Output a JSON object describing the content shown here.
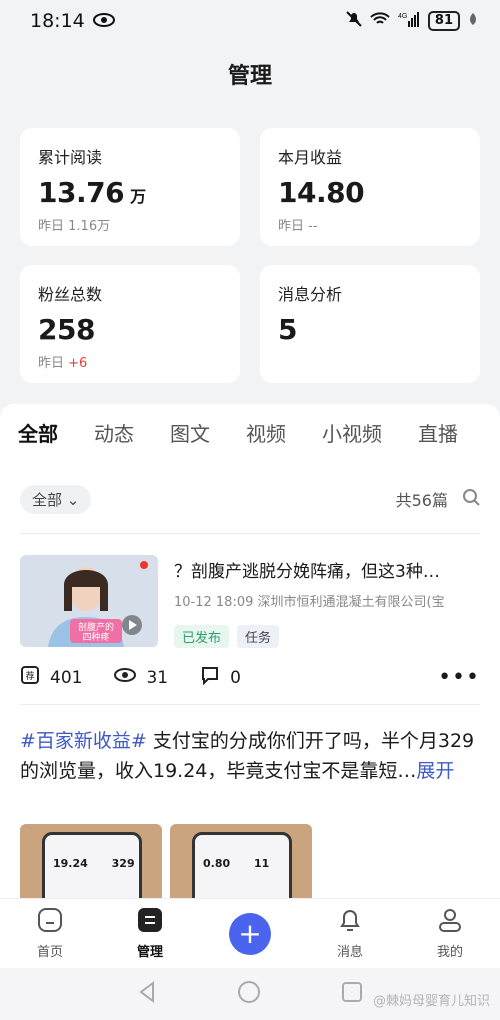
{
  "status": {
    "time": "18:14",
    "battery": "81"
  },
  "page": {
    "title": "管理"
  },
  "cards": [
    {
      "label": "累计阅读",
      "value": "13.76",
      "unit": "万",
      "sub_prefix": "昨日 ",
      "sub_value": "1.16万",
      "sub_delta": ""
    },
    {
      "label": "本月收益",
      "value": "14.80",
      "unit": "",
      "sub_prefix": "昨日 ",
      "sub_value": "--",
      "sub_delta": ""
    },
    {
      "label": "粉丝总数",
      "value": "258",
      "unit": "",
      "sub_prefix": "昨日 ",
      "sub_value": "",
      "sub_delta": "+6"
    },
    {
      "label": "消息分析",
      "value": "5",
      "unit": "",
      "sub_prefix": "",
      "sub_value": "",
      "sub_delta": ""
    }
  ],
  "tabs": [
    "全部",
    "动态",
    "图文",
    "视频",
    "小视频",
    "直播"
  ],
  "filter": {
    "pill": "全部",
    "count": "共56篇"
  },
  "post1": {
    "title": "？剖腹产逃脱分娩阵痛，但这3种…",
    "meta": "10-12 18:09   深圳市恒利通混凝土有限公司(宝",
    "thumb_text": "剖腹产的 四种疼",
    "tags": [
      "已发布",
      "任务"
    ],
    "stats": {
      "recommend": "401",
      "views": "31",
      "comments": "0"
    }
  },
  "post2": {
    "hashtag": "#百家新收益#",
    "text": " 支付宝的分成你们开了吗，半个月329的浏览量，收入19.24，毕竟支付宝不是靠短…",
    "expand": "展开",
    "img1_text": "19.24",
    "img1_text2": "329",
    "img2_text": "0.80",
    "img2_text2": "11"
  },
  "nav": [
    {
      "label": "首页"
    },
    {
      "label": "管理"
    },
    {
      "label": "消息"
    },
    {
      "label": "我的"
    }
  ],
  "watermark": "@棘妈母婴育儿知识"
}
